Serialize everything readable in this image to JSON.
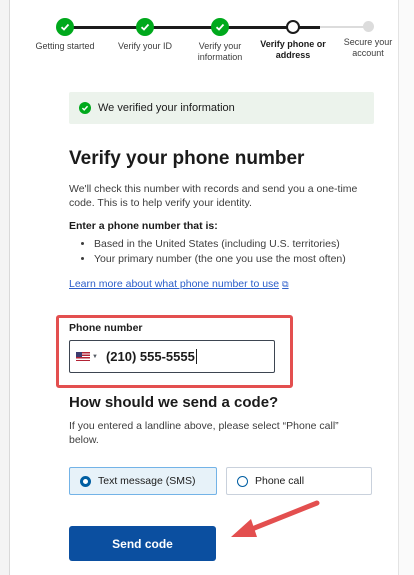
{
  "steps": [
    {
      "label": "Getting started",
      "state": "done"
    },
    {
      "label": "Verify your ID",
      "state": "done"
    },
    {
      "label": "Verify your information",
      "state": "done"
    },
    {
      "label": "Verify phone or address",
      "state": "current"
    },
    {
      "label": "Secure your account",
      "state": "pending"
    }
  ],
  "alert": {
    "text": "We verified your information"
  },
  "page": {
    "title": "Verify your phone number",
    "intro": "We'll check this number with records and send you a one-time code. This is to help verify your identity.",
    "enter_label": "Enter a phone number that is:",
    "bullets": [
      "Based in the United States (including U.S. territories)",
      "Your primary number (the one you use the most often)"
    ],
    "learn_more": "Learn more about what phone number to use"
  },
  "phone": {
    "label": "Phone number",
    "value": "(210) 555-5555"
  },
  "send_method": {
    "title": "How should we send a code?",
    "hint": "If you entered a landline above, please select “Phone call” below.",
    "options": [
      {
        "label": "Text message (SMS)",
        "selected": true
      },
      {
        "label": "Phone call",
        "selected": false
      }
    ]
  },
  "submit": {
    "label": "Send code"
  },
  "colors": {
    "success": "#00a91c",
    "primary": "#0b4fa0",
    "highlight": "#e34f4f",
    "link": "#2c5ec9"
  }
}
